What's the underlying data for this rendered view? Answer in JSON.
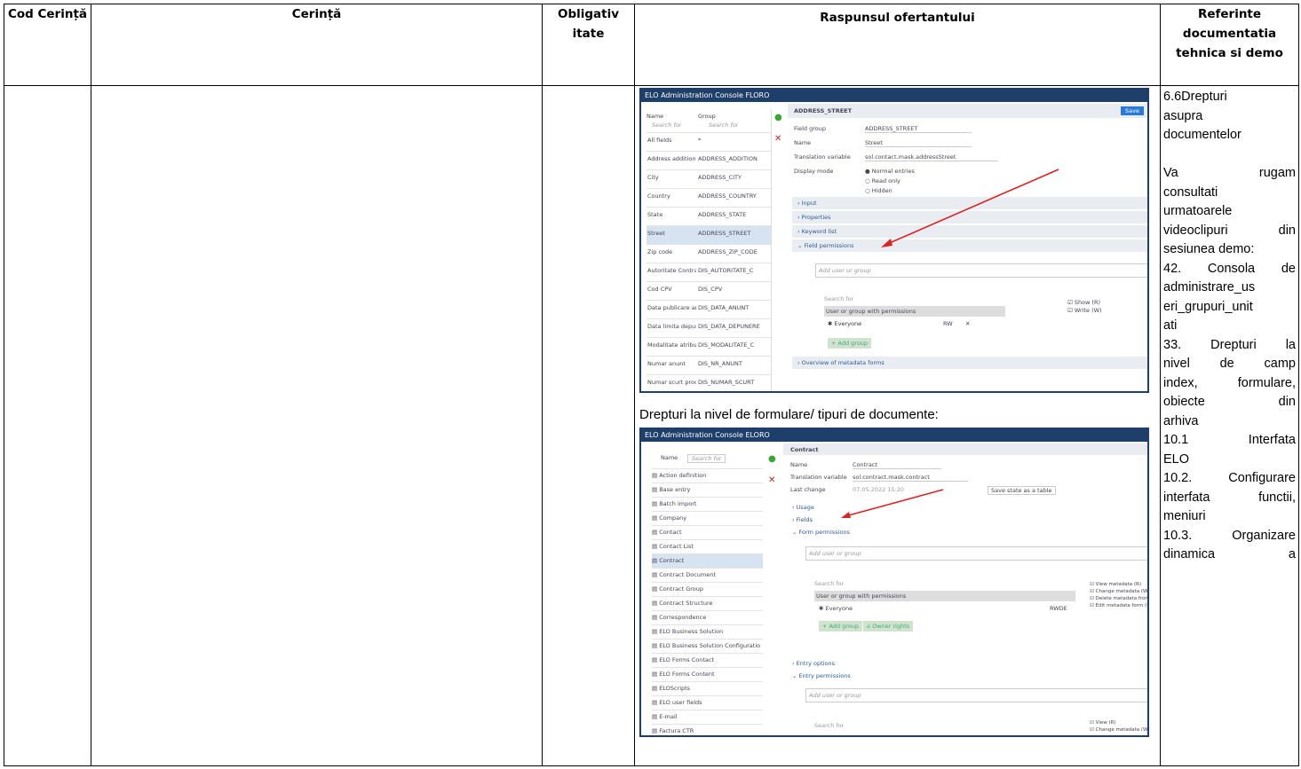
{
  "table": {
    "headers": {
      "cod": "Cod Cerință",
      "cerinta": "Cerință",
      "oblig": "Obligativ itate",
      "raspuns": "Raspunsul ofertantului",
      "ref": "Referinte documentatia tehnica si demo"
    }
  },
  "response": {
    "caption": "Drepturi la nivel de formulare/ tipuri de documente:",
    "shot1": {
      "title": "ELO Administration Console  FLORO",
      "field_title": "ADDRESS_STREET",
      "save": "Save",
      "list_header": [
        "Name",
        "Group"
      ],
      "search": "Search for",
      "rows": [
        [
          "All fields",
          "*"
        ],
        [
          "Address addition",
          "ADDRESS_ADDITION"
        ],
        [
          "City",
          "ADDRESS_CITY"
        ],
        [
          "Country",
          "ADDRESS_COUNTRY"
        ],
        [
          "State",
          "ADDRESS_STATE"
        ],
        [
          "Street",
          "ADDRESS_STREET"
        ],
        [
          "Zip code",
          "ADDRESS_ZIP_CODE"
        ],
        [
          "Autoritate Contractanta",
          "DIS_AUTORITATE_C"
        ],
        [
          "Cod CPV",
          "DIS_CPV"
        ],
        [
          "Data publicare anunt",
          "DIS_DATA_ANUNT"
        ],
        [
          "Data limita depunere",
          "DIS_DATA_DEPUNERE"
        ],
        [
          "Modalitate atribuire",
          "DIS_MODALITATE_C"
        ],
        [
          "Numar anunt",
          "DIS_NR_ANUNT"
        ],
        [
          "Numar scurt procedura",
          "DIS_NUMAR_SCURT"
        ]
      ],
      "form": {
        "field_group_label": "Field group",
        "field_group_value": "ADDRESS_STREET",
        "name_label": "Name",
        "name_value": "Street",
        "translation_label": "Translation variable",
        "translation_value": "sol.contact.mask.addressStreet",
        "display_label": "Display mode",
        "display_options": [
          "Normal entries",
          "Read only",
          "Hidden"
        ],
        "sections": [
          "Input",
          "Properties",
          "Keyword list",
          "Field permissions",
          "Overview of metadata forms"
        ],
        "add_user": "Add user or group",
        "perm_header": "User or group with permissions",
        "perm_row": "Everyone",
        "perm_code": "RW",
        "checks": [
          "Show (R)",
          "Write (W)"
        ],
        "add_group": "Add group"
      }
    },
    "shot2": {
      "title": "ELO Administration Console  ELORO",
      "header": "Contract",
      "search": "Search for",
      "list": [
        "Action definition",
        "Base entry",
        "Batch import",
        "Company",
        "Contact",
        "Contact List",
        "Contract",
        "Contract Document",
        "Contract Group",
        "Contract Structure",
        "Correspondence",
        "ELO Business Solution",
        "ELO Business Solution Configuration",
        "ELO Forms Contact",
        "ELO Forms Content",
        "ELOScripts",
        "ELO user fields",
        "E-mail",
        "Factura CTR"
      ],
      "form": {
        "name_label": "Name",
        "name_value": "Contract",
        "translation_label": "Translation variable",
        "translation_value": "sol.contract.mask.contract",
        "last_change_label": "Last change",
        "last_change_value": "07.05.2022 15:20",
        "save_template": "Save state as a table",
        "sections": [
          "Usage",
          "Fields",
          "Form permissions",
          "Entry options",
          "Entry permissions"
        ],
        "add_user": "Add user or group",
        "perm_header": "User or group with permissions",
        "perm_row": "Everyone",
        "perm_code": "RWDE",
        "checks": [
          "View metadata (R)",
          "Change metadata (W)",
          "Delete metadata from (D)",
          "Edit metadata form (E)"
        ],
        "add_group": "Add group",
        "owner_rights": "Owner rights",
        "checks2": [
          "View (R)",
          "Change metadata (W)"
        ]
      }
    }
  },
  "references": {
    "lines": [
      {
        "t": "6.6Drepturi",
        "j": false
      },
      {
        "t": "asupra",
        "j": false
      },
      {
        "t": "documentelor",
        "j": false
      },
      {
        "t": "",
        "j": false
      },
      {
        "t": "Va rugam",
        "j": true
      },
      {
        "t": "consultati",
        "j": false
      },
      {
        "t": "urmatoarele",
        "j": false
      },
      {
        "t": "videoclipuri din",
        "j": true
      },
      {
        "t": "sesiunea demo:",
        "j": false
      },
      {
        "t": "42. Consola de",
        "j": true
      },
      {
        "t": "administrare_us",
        "j": false
      },
      {
        "t": "eri_grupuri_unit",
        "j": false
      },
      {
        "t": "ati",
        "j": false
      },
      {
        "t": "33. Drepturi la",
        "j": true
      },
      {
        "t": "nivel de camp",
        "j": true
      },
      {
        "t": "index, formulare,",
        "j": true
      },
      {
        "t": "obiecte din",
        "j": true
      },
      {
        "t": "arhiva",
        "j": false
      },
      {
        "t": "10.1 Interfata",
        "j": true
      },
      {
        "t": "ELO",
        "j": false
      },
      {
        "t": "10.2. Configurare",
        "j": true
      },
      {
        "t": "interfata functii,",
        "j": true
      },
      {
        "t": "meniuri",
        "j": false
      },
      {
        "t": "10.3. Organizare",
        "j": true
      },
      {
        "t": "dinamica a",
        "j": true
      }
    ]
  },
  "colors": {
    "elo_navy": "#1f3f6b",
    "accent_red": "#d22",
    "button_blue": "#2b7bd6"
  }
}
